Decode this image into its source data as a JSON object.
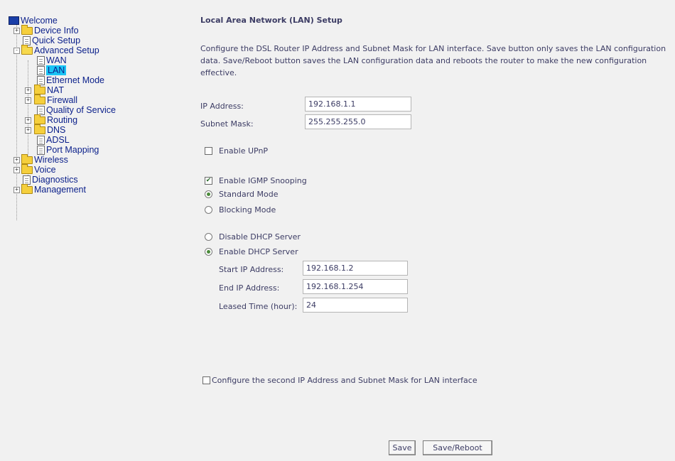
{
  "tree": {
    "welcome": "Welcome",
    "device_info": "Device Info",
    "quick_setup": "Quick Setup",
    "advanced_setup": "Advanced Setup",
    "wan": "WAN",
    "lan": "LAN",
    "ethernet_mode": "Ethernet Mode",
    "nat": "NAT",
    "firewall": "Firewall",
    "qos": "Quality of Service",
    "routing": "Routing",
    "dns": "DNS",
    "adsl": "ADSL",
    "port_mapping": "Port Mapping",
    "wireless": "Wireless",
    "voice": "Voice",
    "diagnostics": "Diagnostics",
    "management": "Management"
  },
  "page": {
    "title": "Local Area Network (LAN) Setup",
    "description": "Configure the DSL Router IP Address and Subnet Mask for LAN interface.  Save button only saves the LAN configuration data.  Save/Reboot button saves the LAN configuration data and reboots the router to make the new configuration effective."
  },
  "form": {
    "ip_label": "IP Address:",
    "ip_value": "192.168.1.1",
    "mask_label": "Subnet Mask:",
    "mask_value": "255.255.255.0",
    "upnp_label": "Enable UPnP",
    "igmp_label": "Enable IGMP Snooping",
    "standard_mode": "Standard Mode",
    "blocking_mode": "Blocking Mode",
    "disable_dhcp": "Disable DHCP Server",
    "enable_dhcp": "Enable DHCP Server",
    "start_ip_label": "Start IP Address:",
    "start_ip_value": "192.168.1.2",
    "end_ip_label": "End IP Address:",
    "end_ip_value": "192.168.1.254",
    "lease_label": "Leased Time (hour):",
    "lease_value": "24",
    "second_ip_label": "Configure the second IP Address and Subnet Mask for LAN interface",
    "igmp_check": "✔"
  },
  "buttons": {
    "save": "Save",
    "save_reboot": "Save/Reboot"
  }
}
